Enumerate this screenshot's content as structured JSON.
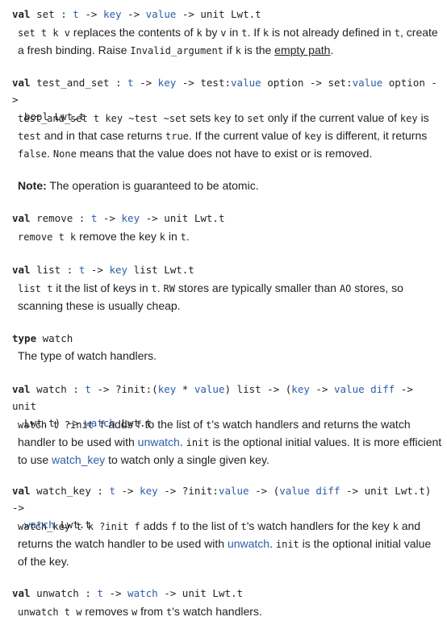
{
  "set": {
    "spec": [
      "val",
      "set",
      ":",
      "t",
      "->",
      "key",
      "->",
      "value",
      "->",
      "unit Lwt.t"
    ],
    "desc": [
      "set t k v",
      "replaces the contents of",
      "k",
      "by",
      "v",
      "in",
      "t",
      ". If",
      "k",
      "is not already defined in",
      "t",
      ", create a fresh binding. Raise",
      "Invalid_argument",
      "if",
      "k",
      "is the",
      "empty path",
      "."
    ]
  },
  "test_and_set": {
    "spec": [
      "val",
      "test_and_set",
      ":",
      "t",
      "->",
      "key",
      "->",
      "test:",
      "value",
      "option ->",
      "set:",
      "value",
      "option ->",
      "bool Lwt.t"
    ],
    "desc": [
      "test_and_set t key ~test ~set",
      "sets",
      "key",
      "to",
      "set",
      "only if the current value of",
      "key",
      "is",
      "test",
      "and in that case returns",
      "true",
      ". If the current value of",
      "key",
      "is different, it returns",
      "false",
      ".",
      "None",
      "means that the value does not have to exist or is removed."
    ]
  },
  "note": {
    "label": "Note:",
    "text": "The operation is guaranteed to be atomic."
  },
  "remove": {
    "spec": [
      "val",
      "remove",
      ":",
      "t",
      "->",
      "key",
      "->",
      "unit Lwt.t"
    ],
    "desc": [
      "remove t k",
      "remove the key",
      "k",
      "in",
      "t",
      "."
    ]
  },
  "list": {
    "spec": [
      "val",
      "list",
      ":",
      "t",
      "->",
      "key",
      "list Lwt.t"
    ],
    "desc": [
      "list t",
      "it the list of keys in",
      "t",
      ".",
      "RW",
      "stores are typically smaller than",
      "AO",
      "stores, so scanning these is usually cheap."
    ]
  },
  "watch_type": {
    "spec": [
      "type",
      "watch"
    ],
    "desc": [
      "The type of watch handlers."
    ]
  },
  "watch": {
    "spec": [
      "val",
      "watch",
      ":",
      "t",
      "->",
      "?init:(",
      "key",
      "*",
      "value",
      ") list -> (",
      "key",
      "->",
      "value diff",
      "->",
      "unit",
      "Lwt.t) ->",
      "watch",
      "Lwt.t"
    ],
    "desc": [
      "watch t ?init f",
      "adds",
      "f",
      "to the list of",
      "t",
      "'s watch handlers and returns the watch handler to be used with",
      "unwatch",
      ".",
      "init",
      "is the optional initial values. It is more efficient to use",
      "watch_key",
      "to watch only a single given key."
    ]
  },
  "watch_key": {
    "spec": [
      "val",
      "watch_key",
      ":",
      "t",
      "->",
      "key",
      "-> ?init:",
      "value",
      "-> (",
      "value diff",
      "-> unit Lwt.t) ->",
      "watch",
      "Lwt.t"
    ],
    "desc": [
      "watch_key t k ?init f",
      "adds",
      "f",
      "to the list of",
      "t",
      "'s watch handlers for the key",
      "k",
      "and returns the watch handler to be used with",
      "unwatch",
      ".",
      "init",
      "is the optional initial value of the key."
    ]
  },
  "unwatch": {
    "spec": [
      "val",
      "unwatch",
      ":",
      "t",
      "->",
      "watch",
      "-> unit Lwt.t"
    ],
    "desc": [
      "unwatch t w",
      "removes",
      "w",
      "from",
      "t",
      "'s watch handlers."
    ]
  }
}
